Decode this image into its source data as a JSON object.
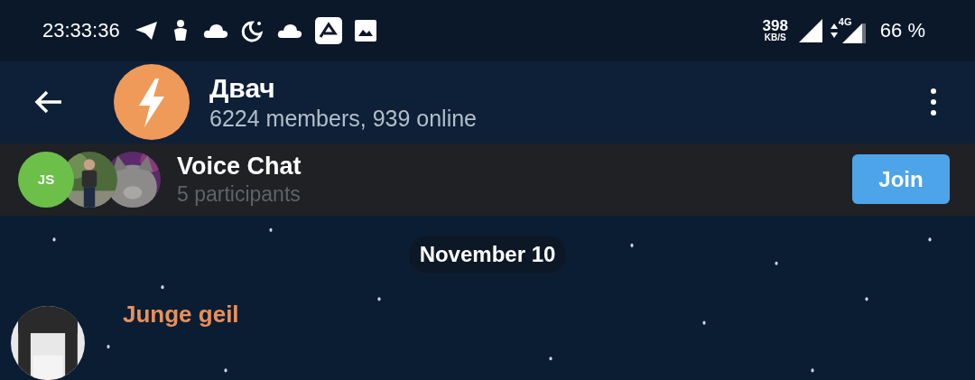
{
  "status_bar": {
    "time": "23:33:36",
    "net_speed": "398",
    "net_unit": "KB/S",
    "network": "4G",
    "battery": "66 %"
  },
  "header": {
    "title": "Двач",
    "subtitle": "6224 members, 939 online"
  },
  "voice_chat": {
    "title": "Voice Chat",
    "participants": "5 participants",
    "avatars": [
      {
        "kind": "initials",
        "text": "JS",
        "color": "#6cc04a"
      },
      {
        "kind": "picture"
      },
      {
        "kind": "picture"
      }
    ],
    "join": "Join"
  },
  "chat": {
    "date": "November 10",
    "messages": [
      {
        "sender": "Junge geil"
      }
    ]
  }
}
